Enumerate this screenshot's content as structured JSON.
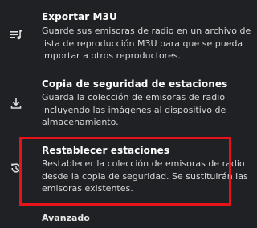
{
  "items": [
    {
      "icon": "playlist-icon",
      "title": "Exportar M3U",
      "desc_lines": [
        "Guarde sus emisoras de radio en un archivo de",
        "lista de reproducción M3U para que se pueda",
        "importar a otros reproductores."
      ]
    },
    {
      "icon": "download-icon",
      "title": "Copia de seguridad de estaciones",
      "desc_lines": [
        "Guarda la colección de emisoras de radio",
        "incluyendo las imágenes al dispositivo de",
        "almacenamiento."
      ]
    },
    {
      "icon": "restore-icon",
      "title": "Restablecer estaciones",
      "desc_lines": [
        "Restablecer la colección de emisoras de radio",
        "desde la copia de seguridad. Se sustituirán las",
        "emisoras existentes."
      ]
    }
  ],
  "section_header": "Avanzado",
  "highlight_color": "#e8121b"
}
